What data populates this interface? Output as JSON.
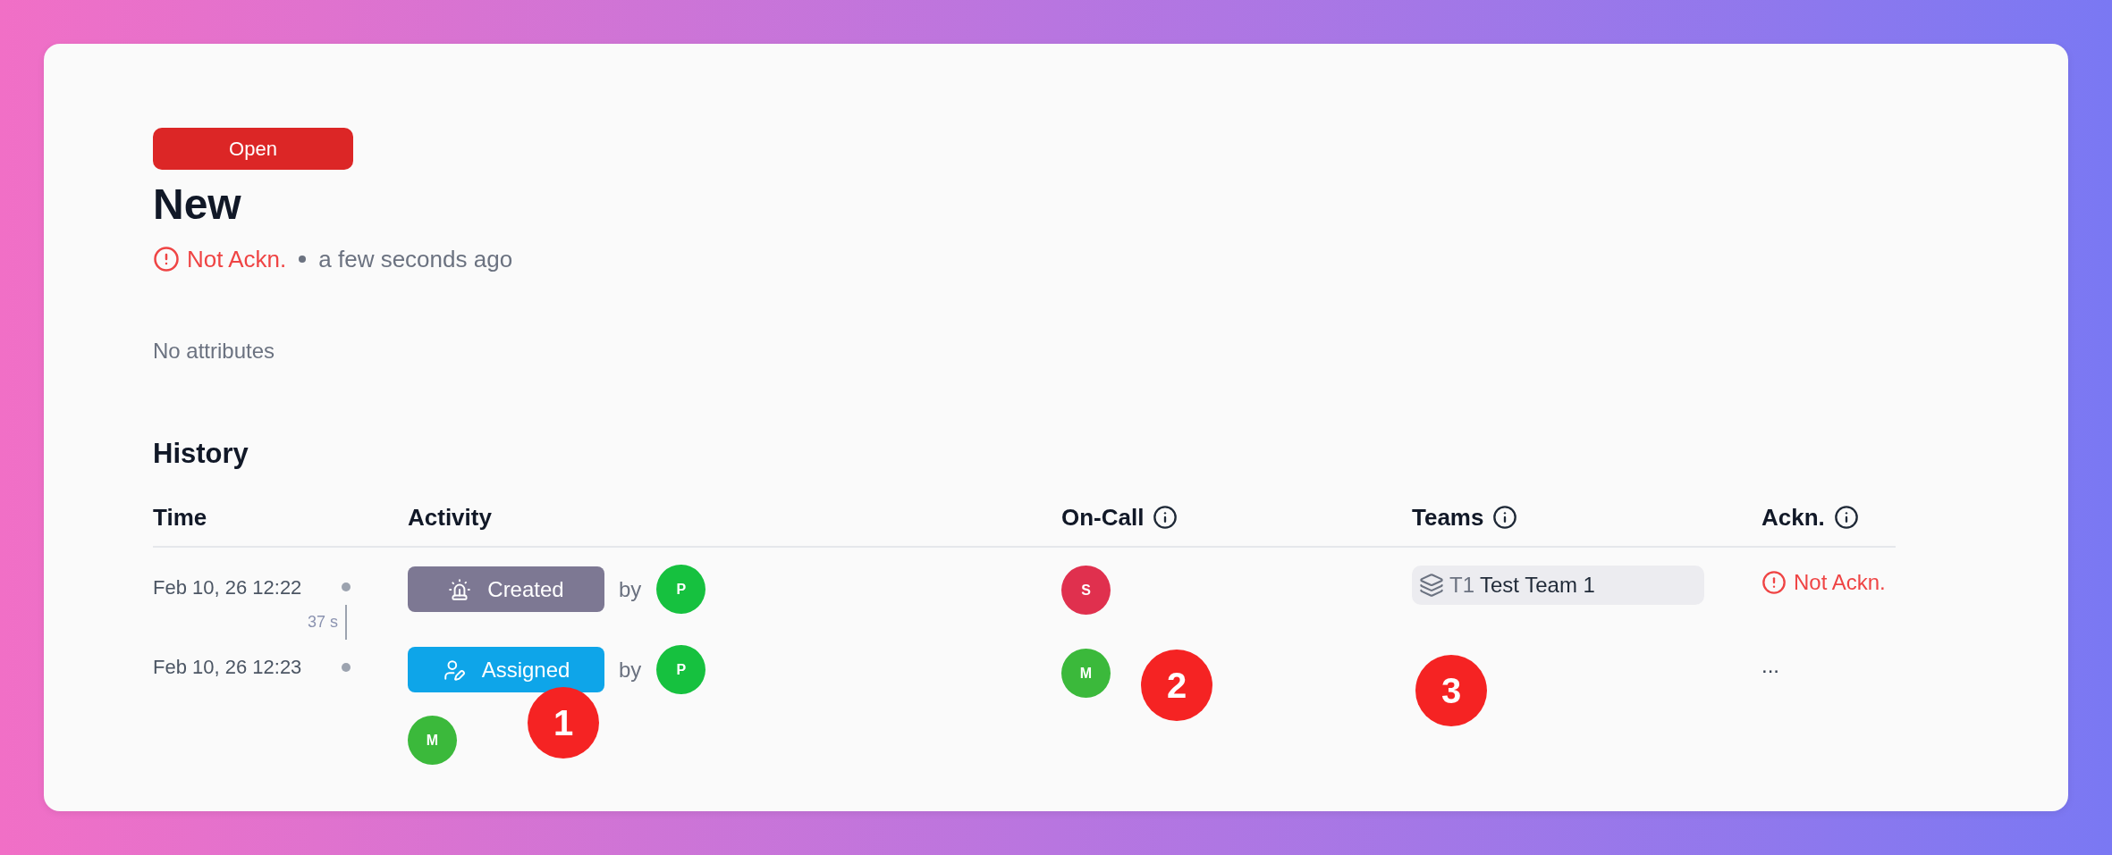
{
  "incident": {
    "status": {
      "kind": "open",
      "label": "Open"
    },
    "title": "New",
    "ack": {
      "kind": "not_acknowledged",
      "label": "Not Ackn."
    },
    "time_ago": "a few seconds ago",
    "attributes_text": "No attributes"
  },
  "history": {
    "title": "History",
    "columns": [
      {
        "label": "Time",
        "info": false
      },
      {
        "label": "Activity",
        "info": false
      },
      {
        "label": "On-Call",
        "info": true
      },
      {
        "label": "Teams",
        "info": true
      },
      {
        "label": "Ackn.",
        "info": true
      }
    ],
    "rows": [
      {
        "time": "Feb 10, 26 12:22",
        "interval_to_next": "37 s",
        "activity": {
          "kind": "created",
          "label": "Created",
          "by_label": "by",
          "by": {
            "initial": "P",
            "color": "#16c13f"
          }
        },
        "on_call": [
          {
            "initial": "S",
            "color": "#e0304e"
          }
        ],
        "teams": [
          {
            "code": "T1",
            "name": "Test Team 1"
          }
        ],
        "ack": {
          "kind": "not_acknowledged",
          "label": "Not Ackn."
        }
      },
      {
        "time": "Feb 10, 26 12:23",
        "activity": {
          "kind": "assigned",
          "label": "Assigned",
          "by_label": "by",
          "by": {
            "initial": "P",
            "color": "#16c13f"
          }
        },
        "assignees": [
          {
            "initial": "M",
            "color": "#3bb93b"
          }
        ],
        "on_call": [
          {
            "initial": "M",
            "color": "#3bb93b"
          }
        ],
        "ack": {
          "kind": "pending",
          "label": "..."
        }
      }
    ]
  },
  "markers": [
    {
      "label": "1"
    },
    {
      "label": "2"
    },
    {
      "label": "3"
    }
  ]
}
